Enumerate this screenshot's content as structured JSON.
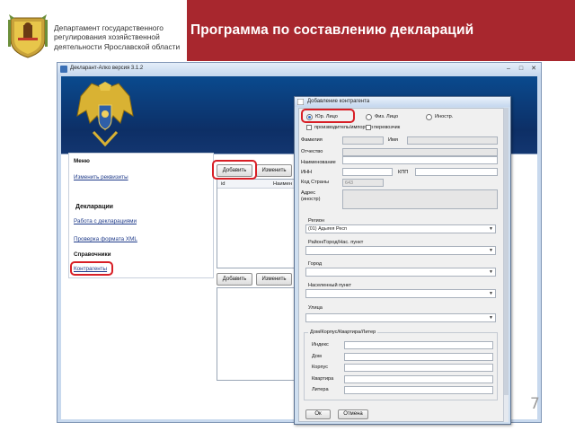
{
  "slide": {
    "department": "Департамент государственного регулирования хозяйственной деятельности Ярославской области",
    "title": "Программа по составлению деклараций",
    "page_number": "7"
  },
  "window": {
    "title": "Декларант-Алко версия 3.1.2",
    "controls": [
      "–",
      "□",
      "✕"
    ]
  },
  "menu": {
    "header": "Меню",
    "change_requisites": "Изменить реквизиты",
    "section_declarations": "Декларации",
    "work_with_declarations": "Работа с декларациями",
    "check_xml": "Проверка формата XML",
    "section_references": "Справочники",
    "counterparties": "Контрагенты"
  },
  "top_grid": {
    "add_button": "Добавить",
    "edit_button": "Изменить",
    "columns": [
      "id",
      "Наимен"
    ]
  },
  "bottom_grid": {
    "add_button": "Добавить",
    "edit_button": "Изменить"
  },
  "dialog": {
    "title": "Добавление контрагента",
    "radios": [
      {
        "label": "Юр. Лицо",
        "selected": true
      },
      {
        "label": "Физ. Лицо",
        "selected": false
      },
      {
        "label": "Иностр.",
        "selected": false
      }
    ],
    "checkboxes": [
      "производитель/импортер",
      "перевозчик"
    ],
    "fields": {
      "surname": "Фамилия",
      "name": "Имя",
      "patronymic": "Отчество",
      "org_name": "Наименование",
      "inn": "ИНН",
      "kpp": "КПП",
      "country_code": "Код Страны",
      "country_code_value": "643",
      "address": "Адрес (иностр)"
    },
    "region_label": "Регион",
    "region_value": "(01) Адыгея Респ",
    "district_label": "Район/Город/Нас. пункт",
    "city_label": "Город",
    "settlement_label": "Населенный пункт",
    "street_label": "Улица",
    "house_group_label": "Дом/Корпус/Квартира/Литер",
    "address_fields": [
      "Индекс",
      "Дом",
      "Корпус",
      "Квартира",
      "Литера"
    ],
    "ok_button": "Ок",
    "cancel_button": "Отмена"
  },
  "colors": {
    "title_bar": "#a8272e",
    "highlight": "#d81f26",
    "banner": "#0d2f66"
  }
}
